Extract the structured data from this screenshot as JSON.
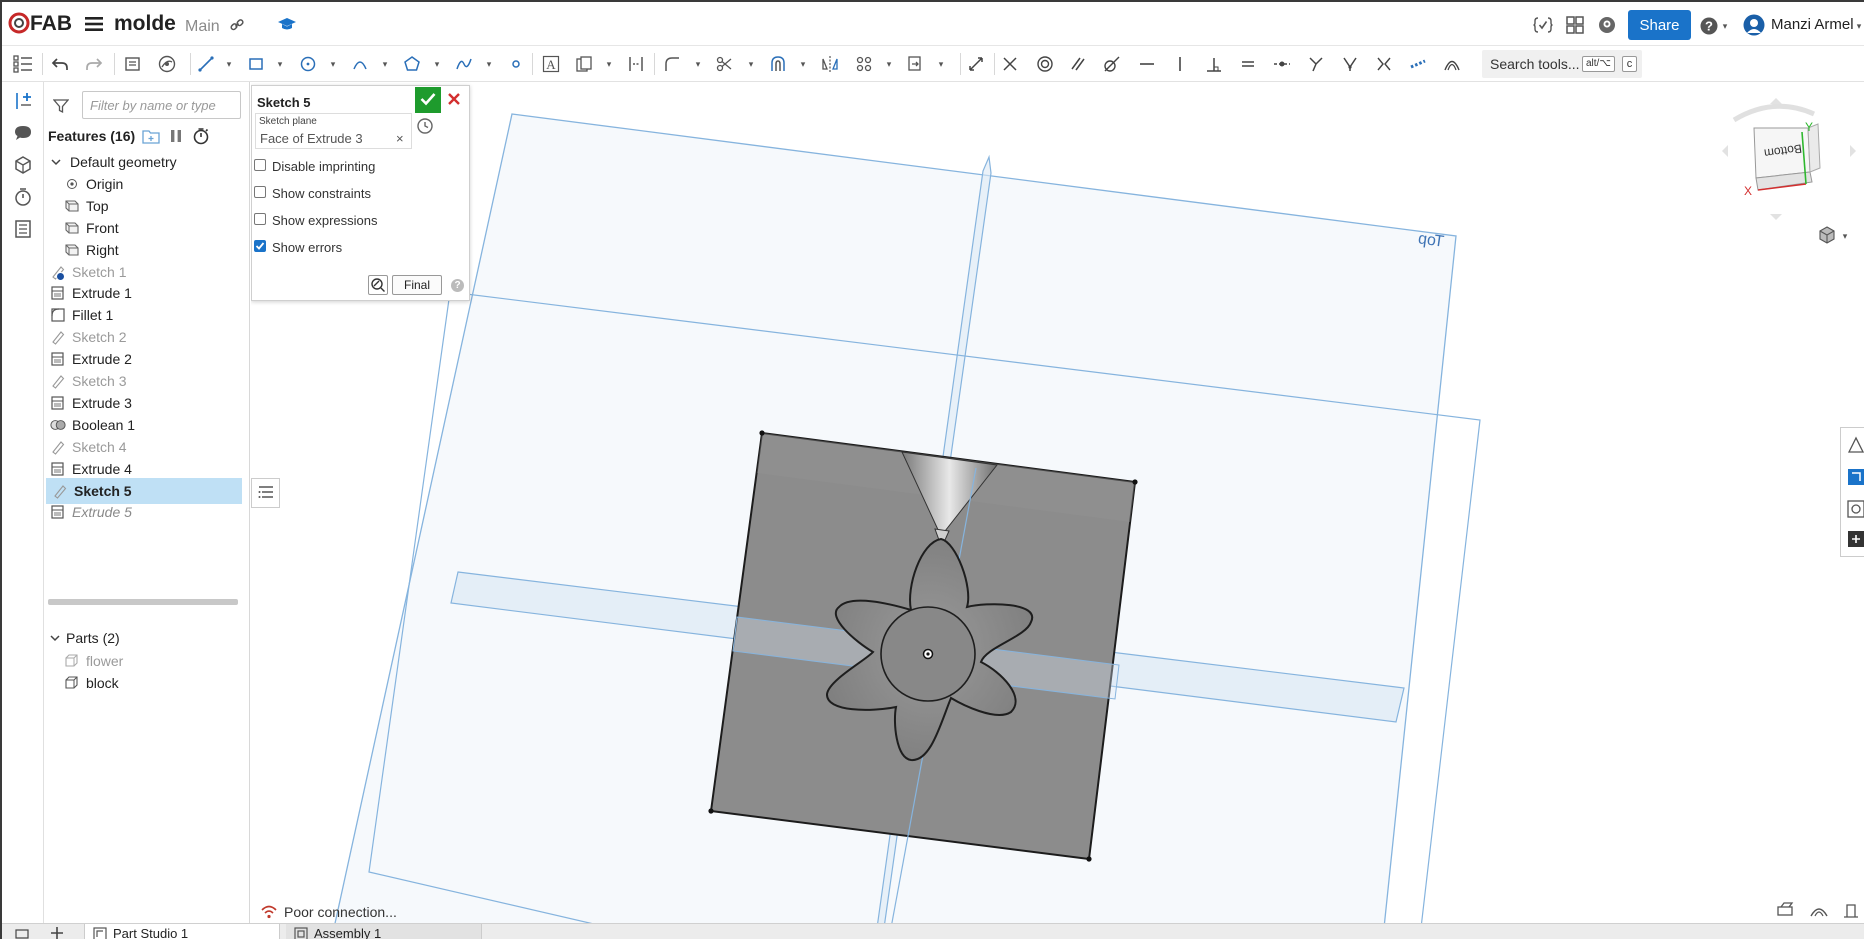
{
  "header": {
    "app_logo": "FAB",
    "doc_name": "molde",
    "branch": "Main",
    "share_label": "Share",
    "user_name": "Manzi Armel"
  },
  "toolbar": {
    "search_label": "Search tools...",
    "shortcut_1": "alt/⌥",
    "shortcut_2": "c"
  },
  "features": {
    "filter_placeholder": "Filter by name or type",
    "header": "Features (16)",
    "items": [
      {
        "label": "Default geometry",
        "icon": "chevron-down-icon",
        "state": "group"
      },
      {
        "label": "Origin",
        "icon": "origin-icon",
        "state": "child"
      },
      {
        "label": "Top",
        "icon": "plane-icon",
        "state": "child"
      },
      {
        "label": "Front",
        "icon": "plane-icon",
        "state": "child"
      },
      {
        "label": "Right",
        "icon": "plane-icon",
        "state": "child"
      },
      {
        "label": "Sketch 1",
        "icon": "sketch-icon",
        "state": "dim"
      },
      {
        "label": "Extrude 1",
        "icon": "extrude-icon",
        "state": "normal"
      },
      {
        "label": "Fillet 1",
        "icon": "fillet-icon",
        "state": "normal"
      },
      {
        "label": "Sketch 2",
        "icon": "sketch-icon",
        "state": "dim"
      },
      {
        "label": "Extrude 2",
        "icon": "extrude-icon",
        "state": "normal"
      },
      {
        "label": "Sketch 3",
        "icon": "sketch-icon",
        "state": "dim"
      },
      {
        "label": "Extrude 3",
        "icon": "extrude-icon",
        "state": "normal"
      },
      {
        "label": "Boolean 1",
        "icon": "boolean-icon",
        "state": "normal"
      },
      {
        "label": "Sketch 4",
        "icon": "sketch-icon",
        "state": "dim"
      },
      {
        "label": "Extrude 4",
        "icon": "extrude-icon",
        "state": "normal"
      },
      {
        "label": "Sketch 5",
        "icon": "sketch-icon",
        "state": "selected"
      },
      {
        "label": "Extrude 5",
        "icon": "extrude-icon",
        "state": "rolledback"
      }
    ],
    "parts_header": "Parts (2)",
    "parts": [
      {
        "label": "flower",
        "state": "dim"
      },
      {
        "label": "block",
        "state": "normal"
      }
    ]
  },
  "sketch_dialog": {
    "title": "Sketch 5",
    "plane_label": "Sketch plane",
    "plane_value": "Face of Extrude 3",
    "options": [
      {
        "label": "Disable imprinting",
        "checked": false
      },
      {
        "label": "Show constraints",
        "checked": false
      },
      {
        "label": "Show expressions",
        "checked": false
      },
      {
        "label": "Show errors",
        "checked": true
      }
    ],
    "final_label": "Final"
  },
  "viewport": {
    "plane_label_top": "Top",
    "view_cube_face": "Bottom",
    "axis_x": "X",
    "axis_y": "Y",
    "status": "Poor connection..."
  },
  "tabs": [
    {
      "label": "Part Studio 1"
    },
    {
      "label": "Assembly 1"
    }
  ],
  "colors": {
    "accent": "#1a73c9",
    "selection": "#bfe0f5",
    "accept": "#1e9b2d",
    "cancel": "#d32f2f",
    "plane": "#7fb0dc",
    "part": "#8c8c8c"
  }
}
